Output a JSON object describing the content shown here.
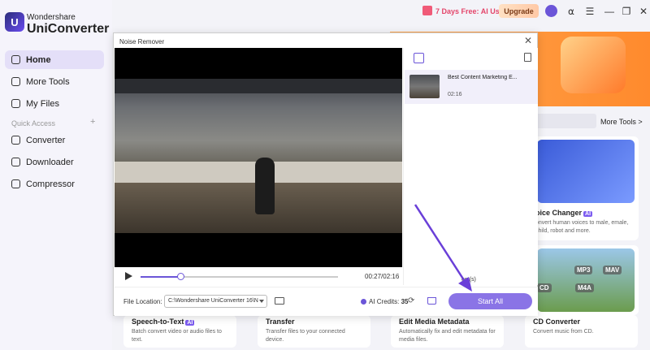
{
  "app": {
    "brand_top": "Wondershare",
    "brand_main": "UniConverter"
  },
  "sidebar": {
    "items": [
      {
        "label": "Home",
        "icon": "home-icon"
      },
      {
        "label": "More Tools",
        "icon": "tools-icon"
      },
      {
        "label": "My Files",
        "icon": "files-icon"
      },
      {
        "label": "Converter",
        "icon": "converter-icon"
      },
      {
        "label": "Downloader",
        "icon": "download-icon"
      },
      {
        "label": "Compressor",
        "icon": "compress-icon"
      }
    ],
    "quick_access": "Quick Access",
    "add_glyph": "+"
  },
  "topbar": {
    "promo": "7 Days Free: AI Use",
    "upgrade": "Upgrade"
  },
  "background": {
    "more_tools": "More Tools >",
    "voice_changer": {
      "title": "oice Changer",
      "desc": "onvert human voices to male, emale, child, robot and more."
    },
    "cd_formats": [
      "MP3",
      "MAV",
      "M4A",
      "CD"
    ],
    "bottom_cards": [
      {
        "title": "Speech-to-Text",
        "ai": true,
        "desc": "Batch convert video or audio files to text."
      },
      {
        "title": "Transfer",
        "ai": false,
        "desc": "Transfer files to your connected device."
      },
      {
        "title": "Edit Media Metadata",
        "ai": false,
        "desc": "Automatically fix and edit metadata for media files."
      },
      {
        "title": "CD Converter",
        "ai": false,
        "desc": "Convert music from CD."
      }
    ],
    "ai_badge": "AI"
  },
  "dialog": {
    "title": "Noise Remover",
    "time": "00:27/02:16",
    "progress": 0.2,
    "file": {
      "name": "Best Content Marketing E...",
      "duration": "02:16"
    },
    "items_count": "em(s)",
    "file_location_label": "File Location:",
    "file_location_value": "C:\\Wondershare UniConverter 16\\N",
    "credits_label": "AI Credits:",
    "credits_value": "35",
    "start_all": "Start All"
  },
  "colors": {
    "accent": "#6b55d8",
    "banner": "#ff8a2d",
    "promo": "#e4456a"
  }
}
